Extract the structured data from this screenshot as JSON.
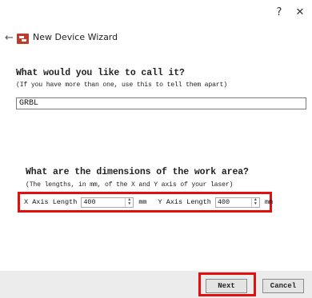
{
  "titlebar": {
    "help_label": "?",
    "close_label": "✕"
  },
  "header": {
    "back_icon": "←",
    "title": "New Device Wizard"
  },
  "name_section": {
    "heading": "What would you like to call it?",
    "subheading": "(If you have more than one, use this to tell them apart)",
    "value": "GRBL"
  },
  "dimensions_section": {
    "heading": "What are the dimensions of the work area?",
    "subheading": "(The lengths, in mm, of the X and Y axis of your laser)",
    "x_label": "X Axis Length",
    "x_value": "400",
    "x_unit": "mm",
    "y_label": "Y Axis Length",
    "y_value": "400",
    "y_unit": "mm"
  },
  "footer": {
    "next_label": "Next",
    "cancel_label": "Cancel"
  },
  "colors": {
    "highlight": "#e01010",
    "logo": "#c0392b"
  }
}
